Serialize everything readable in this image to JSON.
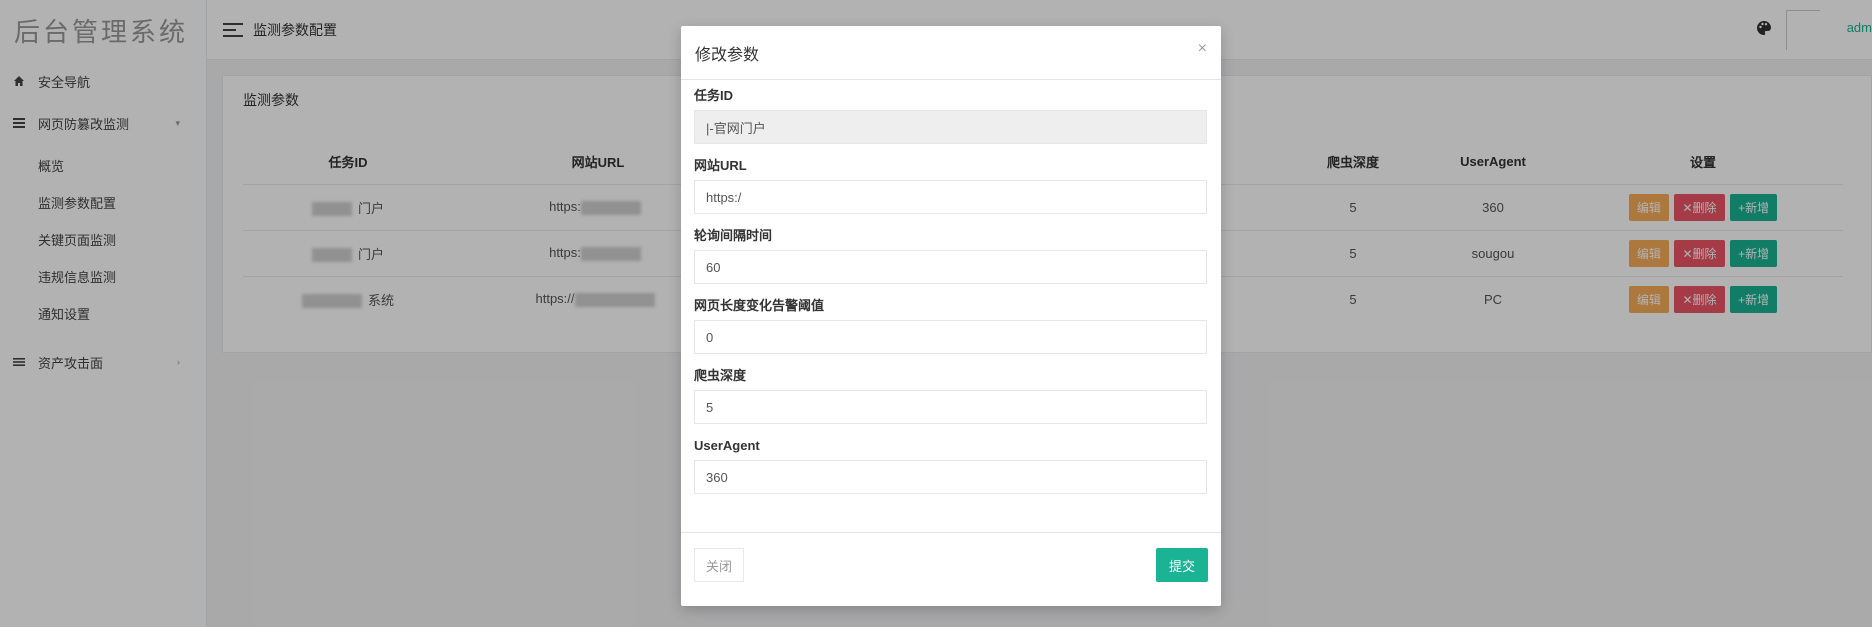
{
  "brand": "后台管理系统",
  "sidebar": {
    "items": [
      {
        "label": "安全导航"
      },
      {
        "label": "网页防篡改监测"
      },
      {
        "label": "资产攻击面"
      }
    ],
    "sub_items": [
      "概览",
      "监测参数配置",
      "关键页面监测",
      "违规信息监测",
      "通知设置"
    ]
  },
  "topbar": {
    "breadcrumb": "监测参数配置",
    "username": "adm"
  },
  "panel": {
    "title": "监测参数",
    "columns": [
      "任务ID",
      "网站URL",
      "爬虫深度",
      "UserAgent",
      "设置"
    ],
    "rows": [
      {
        "task_suffix": "门户",
        "url_prefix": "https:",
        "depth": "5",
        "ua": "360"
      },
      {
        "task_suffix": "门户",
        "url_prefix": "https:",
        "depth": "5",
        "ua": "sougou"
      },
      {
        "task_suffix": "系统",
        "url_prefix": "https://",
        "depth": "5",
        "ua": "PC"
      }
    ],
    "actions": {
      "edit": "编辑",
      "delete": "✕删除",
      "add": "+新增"
    }
  },
  "modal": {
    "title": "修改参数",
    "close_icon": "×",
    "fields": [
      {
        "label": "任务ID",
        "value": "|-官网门户"
      },
      {
        "label": "网站URL",
        "value": "https:/"
      },
      {
        "label": "轮询间隔时间",
        "value": "60"
      },
      {
        "label": "网页长度变化告警阈值",
        "value": "0"
      },
      {
        "label": "爬虫深度",
        "value": "5"
      },
      {
        "label": "UserAgent",
        "value": "360"
      }
    ],
    "close_button": "关闭",
    "submit_button": "提交"
  },
  "colors": {
    "accent": "#1ab394",
    "warning": "#f8ac59",
    "danger": "#ed5565"
  }
}
